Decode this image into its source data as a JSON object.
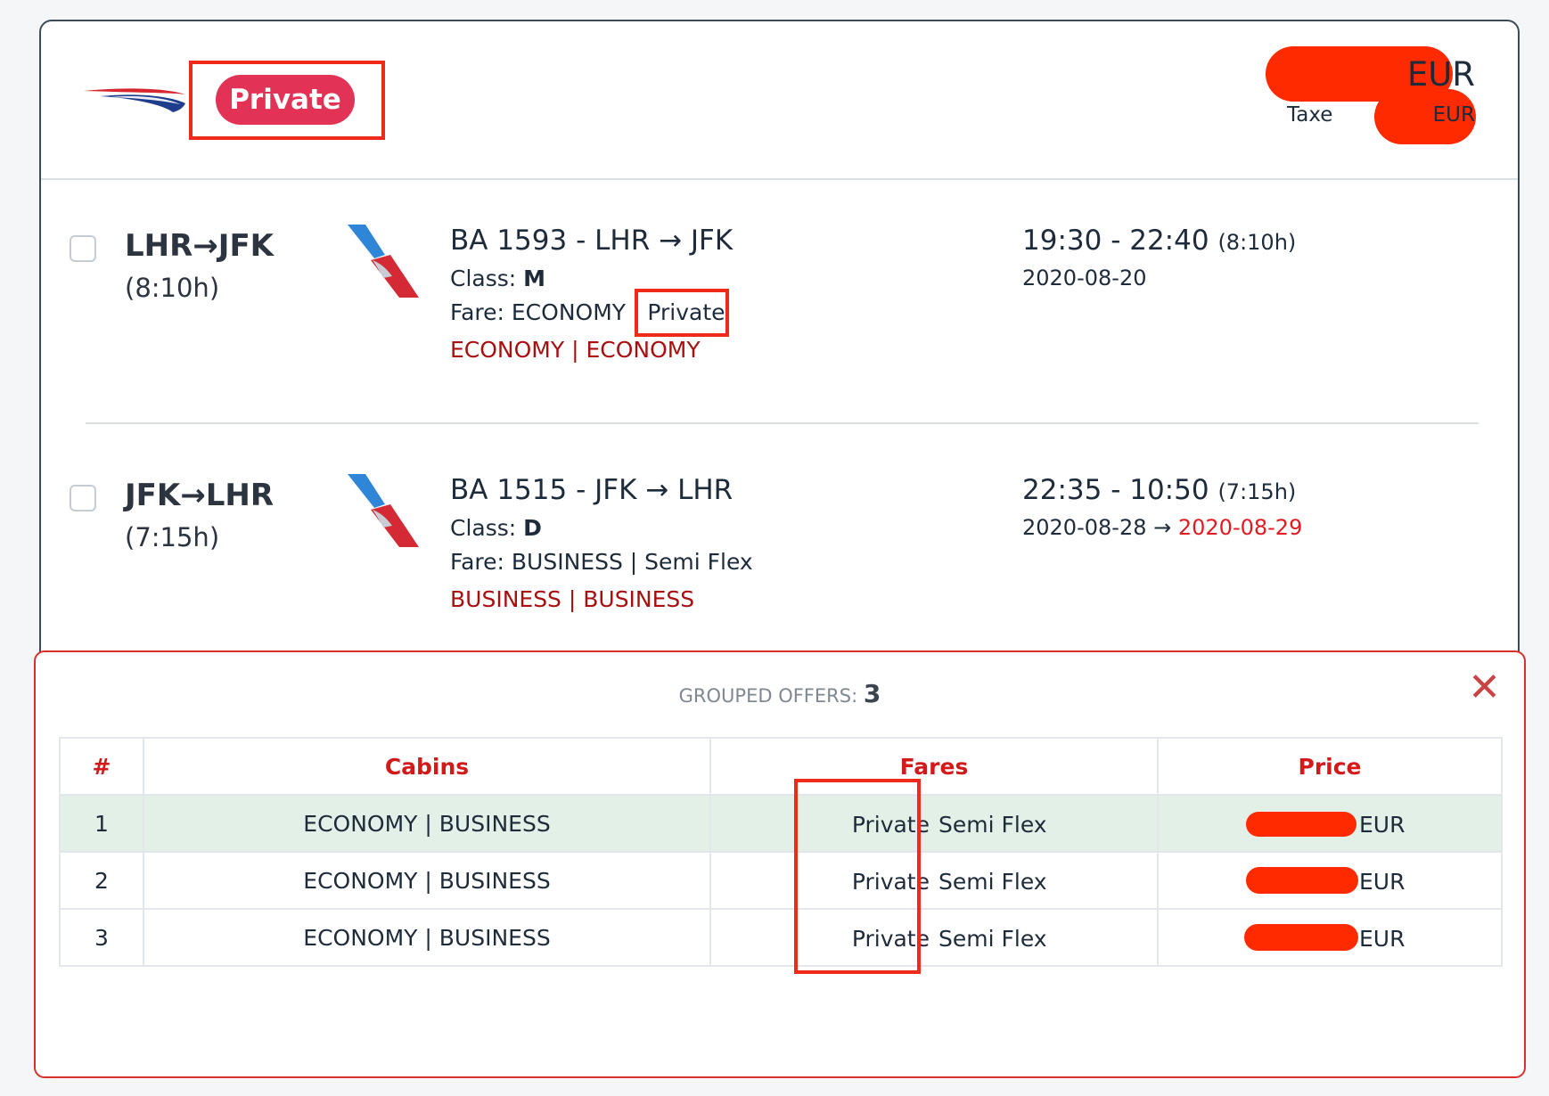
{
  "header": {
    "badge_label": "Private",
    "price_currency": "EUR",
    "tax_label": "Taxe",
    "tax_currency": "EUR"
  },
  "segments": [
    {
      "route": "LHR→JFK",
      "duration": "(8:10h)",
      "flight_title": "BA 1593 - LHR → JFK",
      "class_label": "Class:",
      "class_value": "M",
      "fare_text": "Fare: ECONOMY |",
      "fare_private": "Private",
      "cabins": "ECONOMY | ECONOMY",
      "times": "19:30 - 22:40",
      "time_duration": "(8:10h)",
      "date": "2020-08-20"
    },
    {
      "route": "JFK→LHR",
      "duration": "(7:15h)",
      "flight_title": "BA 1515 - JFK → LHR",
      "class_label": "Class:",
      "class_value": "D",
      "fare_text": "Fare: BUSINESS | Semi Flex",
      "cabins": "BUSINESS | BUSINESS",
      "times": "22:35 - 10:50",
      "time_duration": "(7:15h)",
      "date": "2020-08-28 →",
      "date_arrival": "2020-08-29"
    }
  ],
  "panel": {
    "grouped_label": "GROUPED OFFERS:",
    "grouped_count": "3",
    "close_glyph": "✕",
    "columns": [
      "#",
      "Cabins",
      "Fares",
      "Price"
    ],
    "rows": [
      {
        "num": "1",
        "cabins": "ECONOMY | BUSINESS",
        "fare_a": "Private",
        "fare_b": "Semi Flex",
        "currency": "EUR"
      },
      {
        "num": "2",
        "cabins": "ECONOMY | BUSINESS",
        "fare_a": "Private",
        "fare_b": "Semi Flex",
        "currency": "EUR"
      },
      {
        "num": "3",
        "cabins": "ECONOMY | BUSINESS",
        "fare_a": "Private",
        "fare_b": "Semi Flex",
        "currency": "EUR"
      }
    ]
  },
  "colors": {
    "badge": "#e23356",
    "redaction": "#ff2a00",
    "highlight_box": "#f02a1a",
    "cabin_text": "#a80f10",
    "table_header": "#d21a1a",
    "highlight_row": "#e3f0e7"
  },
  "icons": [
    "british-airways-logo-icon",
    "american-airlines-tail-icon",
    "close-icon"
  ]
}
